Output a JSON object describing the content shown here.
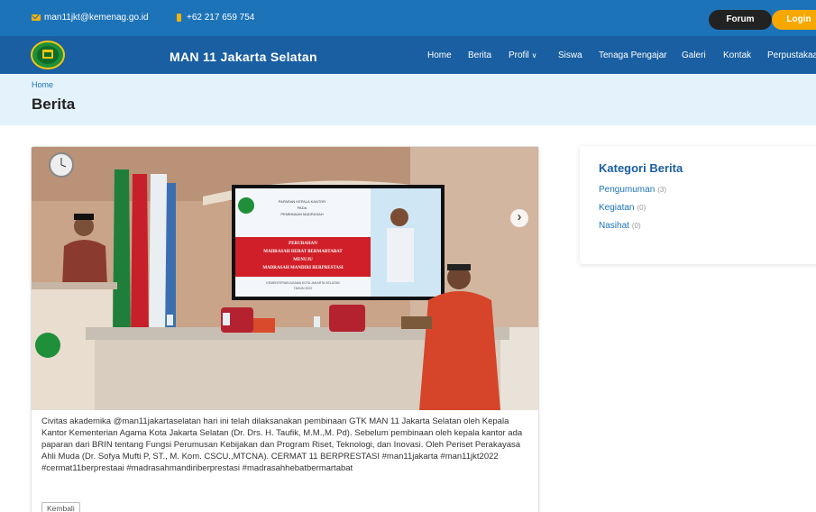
{
  "topbar": {
    "email": "man11jkt@kemenag.go.id",
    "phone": "+62 217 659 754",
    "forum_label": "Forum",
    "login_label": "Login"
  },
  "nav": {
    "site_title": "MAN 11 Jakarta Selatan",
    "items": [
      "Home",
      "Berita",
      "Profil",
      "Siswa",
      "Tenaga Pengajar",
      "Galeri",
      "Kontak",
      "Perpustakaan"
    ]
  },
  "header": {
    "breadcrumb": "Home",
    "title": "Berita"
  },
  "article": {
    "body": "Civitas akademika @man11jakartaselatan hari ini telah dilaksanakan pembinaan GTK MAN 11 Jakarta Selatan oleh Kepala Kantor Kementerian Agama Kota Jakarta Selatan (Dr. Drs. H. Taufik, M.M.,M. Pd). Sebelum pembinaan oleh kepala kantor ada paparan dari BRIN tentang Fungsi Perumusan Kebijakan dan Program Riset, Teknologi, dan Inovasi. Oleh Periset Perakayasa Ahli Muda (Dr. Sofya Mufti P, ST., M. Kom. CSCU.,MTCNA). CERMAT 11 BERPRESTASI #man11jakarta #man11jkt2022 #cermat11berprestaai #madrasahmandiriberprestasi #madrasahhebatbermartabat",
    "back_label": "Kembali",
    "slide": {
      "line1": "PAPARAN KEPALA KANTOR",
      "line2": "PADA",
      "line3": "PEMBINAAN MADRASAH",
      "banner1": "PERUBAHAN",
      "banner2": "MADRASAH HEBAT BERMARTABAT",
      "banner3": "MENUJU",
      "banner4": "MADRASAH MANDIRI BERPRESTASI",
      "footer": "KEMENTERIAN AGAMA KOTA JAKARTA SELATAN",
      "year": "TAHUN 2022"
    }
  },
  "sidebar": {
    "title": "Kategori Berita",
    "categories": [
      {
        "name": "Pengumuman",
        "count": "(3)"
      },
      {
        "name": "Kegiatan",
        "count": "(0)"
      },
      {
        "name": "Nasihat",
        "count": "(0)"
      }
    ]
  },
  "colors": {
    "topbar": "#1d73b8",
    "navbar": "#1a5fa2",
    "accent": "#f6a800",
    "header_bg": "#e4f3fb"
  },
  "icons": [
    "email-icon",
    "phone-icon",
    "chevron-down-icon",
    "chevron-right-icon",
    "school-logo"
  ]
}
